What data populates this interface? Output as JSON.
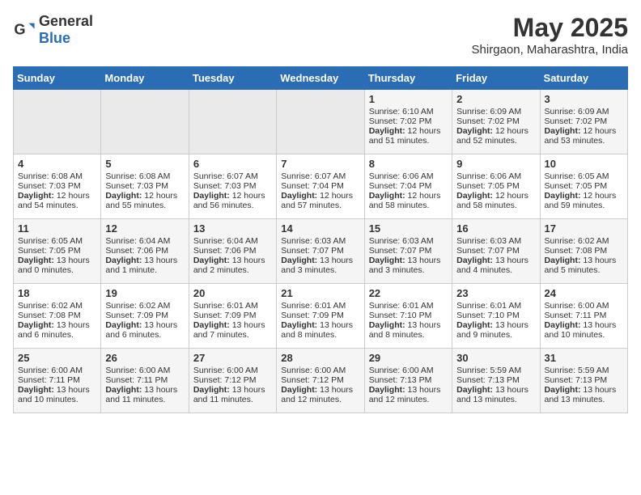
{
  "header": {
    "logo_general": "General",
    "logo_blue": "Blue",
    "month_year": "May 2025",
    "location": "Shirgaon, Maharashtra, India"
  },
  "weekdays": [
    "Sunday",
    "Monday",
    "Tuesday",
    "Wednesday",
    "Thursday",
    "Friday",
    "Saturday"
  ],
  "weeks": [
    [
      {
        "day": "",
        "content": []
      },
      {
        "day": "",
        "content": []
      },
      {
        "day": "",
        "content": []
      },
      {
        "day": "",
        "content": []
      },
      {
        "day": "1",
        "content": [
          "Sunrise: 6:10 AM",
          "Sunset: 7:02 PM",
          "Daylight: 12 hours and 51 minutes."
        ]
      },
      {
        "day": "2",
        "content": [
          "Sunrise: 6:09 AM",
          "Sunset: 7:02 PM",
          "Daylight: 12 hours and 52 minutes."
        ]
      },
      {
        "day": "3",
        "content": [
          "Sunrise: 6:09 AM",
          "Sunset: 7:02 PM",
          "Daylight: 12 hours and 53 minutes."
        ]
      }
    ],
    [
      {
        "day": "4",
        "content": [
          "Sunrise: 6:08 AM",
          "Sunset: 7:03 PM",
          "Daylight: 12 hours and 54 minutes."
        ]
      },
      {
        "day": "5",
        "content": [
          "Sunrise: 6:08 AM",
          "Sunset: 7:03 PM",
          "Daylight: 12 hours and 55 minutes."
        ]
      },
      {
        "day": "6",
        "content": [
          "Sunrise: 6:07 AM",
          "Sunset: 7:03 PM",
          "Daylight: 12 hours and 56 minutes."
        ]
      },
      {
        "day": "7",
        "content": [
          "Sunrise: 6:07 AM",
          "Sunset: 7:04 PM",
          "Daylight: 12 hours and 57 minutes."
        ]
      },
      {
        "day": "8",
        "content": [
          "Sunrise: 6:06 AM",
          "Sunset: 7:04 PM",
          "Daylight: 12 hours and 58 minutes."
        ]
      },
      {
        "day": "9",
        "content": [
          "Sunrise: 6:06 AM",
          "Sunset: 7:05 PM",
          "Daylight: 12 hours and 58 minutes."
        ]
      },
      {
        "day": "10",
        "content": [
          "Sunrise: 6:05 AM",
          "Sunset: 7:05 PM",
          "Daylight: 12 hours and 59 minutes."
        ]
      }
    ],
    [
      {
        "day": "11",
        "content": [
          "Sunrise: 6:05 AM",
          "Sunset: 7:05 PM",
          "Daylight: 13 hours and 0 minutes."
        ]
      },
      {
        "day": "12",
        "content": [
          "Sunrise: 6:04 AM",
          "Sunset: 7:06 PM",
          "Daylight: 13 hours and 1 minute."
        ]
      },
      {
        "day": "13",
        "content": [
          "Sunrise: 6:04 AM",
          "Sunset: 7:06 PM",
          "Daylight: 13 hours and 2 minutes."
        ]
      },
      {
        "day": "14",
        "content": [
          "Sunrise: 6:03 AM",
          "Sunset: 7:07 PM",
          "Daylight: 13 hours and 3 minutes."
        ]
      },
      {
        "day": "15",
        "content": [
          "Sunrise: 6:03 AM",
          "Sunset: 7:07 PM",
          "Daylight: 13 hours and 3 minutes."
        ]
      },
      {
        "day": "16",
        "content": [
          "Sunrise: 6:03 AM",
          "Sunset: 7:07 PM",
          "Daylight: 13 hours and 4 minutes."
        ]
      },
      {
        "day": "17",
        "content": [
          "Sunrise: 6:02 AM",
          "Sunset: 7:08 PM",
          "Daylight: 13 hours and 5 minutes."
        ]
      }
    ],
    [
      {
        "day": "18",
        "content": [
          "Sunrise: 6:02 AM",
          "Sunset: 7:08 PM",
          "Daylight: 13 hours and 6 minutes."
        ]
      },
      {
        "day": "19",
        "content": [
          "Sunrise: 6:02 AM",
          "Sunset: 7:09 PM",
          "Daylight: 13 hours and 6 minutes."
        ]
      },
      {
        "day": "20",
        "content": [
          "Sunrise: 6:01 AM",
          "Sunset: 7:09 PM",
          "Daylight: 13 hours and 7 minutes."
        ]
      },
      {
        "day": "21",
        "content": [
          "Sunrise: 6:01 AM",
          "Sunset: 7:09 PM",
          "Daylight: 13 hours and 8 minutes."
        ]
      },
      {
        "day": "22",
        "content": [
          "Sunrise: 6:01 AM",
          "Sunset: 7:10 PM",
          "Daylight: 13 hours and 8 minutes."
        ]
      },
      {
        "day": "23",
        "content": [
          "Sunrise: 6:01 AM",
          "Sunset: 7:10 PM",
          "Daylight: 13 hours and 9 minutes."
        ]
      },
      {
        "day": "24",
        "content": [
          "Sunrise: 6:00 AM",
          "Sunset: 7:11 PM",
          "Daylight: 13 hours and 10 minutes."
        ]
      }
    ],
    [
      {
        "day": "25",
        "content": [
          "Sunrise: 6:00 AM",
          "Sunset: 7:11 PM",
          "Daylight: 13 hours and 10 minutes."
        ]
      },
      {
        "day": "26",
        "content": [
          "Sunrise: 6:00 AM",
          "Sunset: 7:11 PM",
          "Daylight: 13 hours and 11 minutes."
        ]
      },
      {
        "day": "27",
        "content": [
          "Sunrise: 6:00 AM",
          "Sunset: 7:12 PM",
          "Daylight: 13 hours and 11 minutes."
        ]
      },
      {
        "day": "28",
        "content": [
          "Sunrise: 6:00 AM",
          "Sunset: 7:12 PM",
          "Daylight: 13 hours and 12 minutes."
        ]
      },
      {
        "day": "29",
        "content": [
          "Sunrise: 6:00 AM",
          "Sunset: 7:13 PM",
          "Daylight: 13 hours and 12 minutes."
        ]
      },
      {
        "day": "30",
        "content": [
          "Sunrise: 5:59 AM",
          "Sunset: 7:13 PM",
          "Daylight: 13 hours and 13 minutes."
        ]
      },
      {
        "day": "31",
        "content": [
          "Sunrise: 5:59 AM",
          "Sunset: 7:13 PM",
          "Daylight: 13 hours and 13 minutes."
        ]
      }
    ]
  ]
}
